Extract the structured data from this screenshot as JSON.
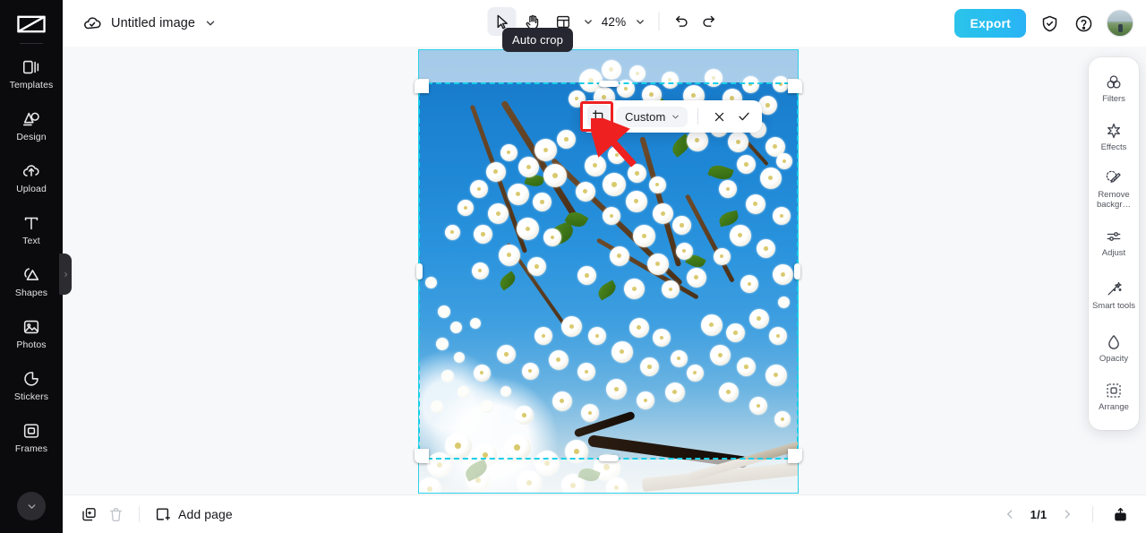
{
  "app": {
    "brand_icon": "capcut-logo-icon",
    "canvas_bg": "#f7f8fa",
    "accent": "#27bdf0",
    "crop_outline": "#17cfe8",
    "annotation_color": "#ee2020"
  },
  "sidebar": {
    "items": [
      {
        "label": "Templates",
        "icon": "templates-icon"
      },
      {
        "label": "Design",
        "icon": "design-icon"
      },
      {
        "label": "Upload",
        "icon": "upload-cloud-icon"
      },
      {
        "label": "Text",
        "icon": "text-icon"
      },
      {
        "label": "Shapes",
        "icon": "shapes-icon"
      },
      {
        "label": "Photos",
        "icon": "photos-icon"
      },
      {
        "label": "Stickers",
        "icon": "stickers-icon"
      },
      {
        "label": "Frames",
        "icon": "frames-icon"
      }
    ],
    "scroll_down_icon": "chevron-down-icon",
    "panel_handle_icon": "chevron-right-icon"
  },
  "topbar": {
    "cloud_icon": "cloud-saved-icon",
    "document_title": "Untitled image",
    "title_dropdown_icon": "chevron-down-icon",
    "tools": [
      {
        "name": "select-tool",
        "icon": "cursor-arrow-icon",
        "active": true
      },
      {
        "name": "hand-tool",
        "icon": "hand-icon",
        "active": false
      },
      {
        "name": "layout-tool",
        "icon": "layout-grid-icon",
        "active": false
      }
    ],
    "tools_dropdown_icon": "chevron-down-icon",
    "zoom_level": "42%",
    "zoom_dropdown_icon": "chevron-down-icon",
    "undo_icon": "undo-arrow-icon",
    "redo_icon": "redo-arrow-icon",
    "export_label": "Export",
    "shield_icon": "shield-check-icon",
    "help_icon": "question-circle-icon",
    "avatar_icon": "user-avatar"
  },
  "tooltip": {
    "text": "Auto crop"
  },
  "crop_toolbar": {
    "crop_icon": "auto-crop-icon",
    "ratio_label": "Custom",
    "ratio_dropdown_icon": "chevron-down-icon",
    "cancel_icon": "close-x-icon",
    "confirm_icon": "check-icon"
  },
  "canvas": {
    "image_alt": "white cherry blossom branches against blue sky",
    "selection_state": "cropping"
  },
  "right_panel": {
    "items": [
      {
        "label": "Filters",
        "icon": "filters-icon"
      },
      {
        "label": "Effects",
        "icon": "effects-sparkle-icon"
      },
      {
        "label": "Remove\nbackgr…",
        "icon": "remove-background-icon"
      },
      {
        "label": "Adjust",
        "icon": "adjust-sliders-icon"
      },
      {
        "label": "Smart\ntools",
        "icon": "smart-tools-wand-icon"
      },
      {
        "label": "Opacity",
        "icon": "opacity-droplet-icon"
      },
      {
        "label": "Arrange",
        "icon": "arrange-icon"
      }
    ]
  },
  "bottombar": {
    "duplicate_icon": "duplicate-page-icon",
    "delete_icon": "trash-icon",
    "add_page_icon": "add-page-icon",
    "add_page_label": "Add page",
    "prev_page_icon": "chevron-left-icon",
    "page_indicator": "1/1",
    "next_page_icon": "chevron-right-icon",
    "export_page_icon": "export-page-icon"
  }
}
